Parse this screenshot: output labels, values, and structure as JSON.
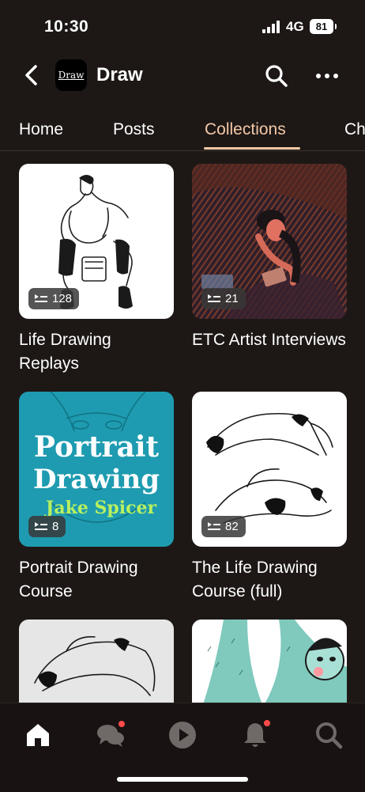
{
  "status_bar": {
    "time": "10:30",
    "network": "4G",
    "battery": "81"
  },
  "header": {
    "title": "Draw",
    "logo_text": "Draw"
  },
  "tabs": [
    {
      "label": "Home",
      "active": false
    },
    {
      "label": "Posts",
      "active": false
    },
    {
      "label": "Collections",
      "active": true
    },
    {
      "label": "Ch",
      "active": false
    }
  ],
  "collections": [
    {
      "title": "Life Drawing Replays",
      "count": "128"
    },
    {
      "title": "ETC Artist Interviews",
      "count": "21"
    },
    {
      "title": "Portrait Drawing Course",
      "count": "8",
      "cover_lines": [
        "Portrait",
        "Drawing",
        "Jake Spicer"
      ]
    },
    {
      "title": "The Life Drawing Course (full)",
      "count": "82"
    },
    {
      "title": "",
      "count": ""
    },
    {
      "title": "",
      "count": ""
    }
  ],
  "colors": {
    "background": "#1d1816",
    "accent": "#f4c8a6",
    "notification": "#ff4a4a",
    "teal_cover": "#1e9bb0"
  },
  "bottom_nav": [
    "home-icon",
    "chat-icon",
    "play-icon",
    "bell-icon",
    "search-icon"
  ]
}
